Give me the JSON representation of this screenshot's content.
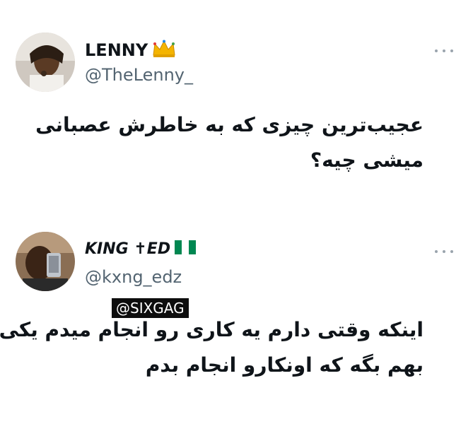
{
  "tweets": [
    {
      "display_name": "LENNY",
      "badge_icon": "crown-icon",
      "handle": "@TheLenny_",
      "more_icon": "more-options-icon",
      "text_lines": [
        "عجیب‌ترین چیزی که به خاطرش عصبانی",
        "میشی چیه؟"
      ]
    },
    {
      "display_name": "KING ✝ED",
      "badge_icon": "nigeria-flag-icon",
      "handle": "@kxng_edz",
      "more_icon": "more-options-icon",
      "text_lines": [
        "اینکه وقتی دارم یه کاری رو انجام میدم یکی",
        "بهم بگه که اونکارو انجام بدم"
      ]
    }
  ],
  "watermark": "@SIXGAG",
  "colors": {
    "text": "#0f1419",
    "handle": "#536471",
    "dots": "#9aa4ad",
    "flag_green": "#008751"
  }
}
